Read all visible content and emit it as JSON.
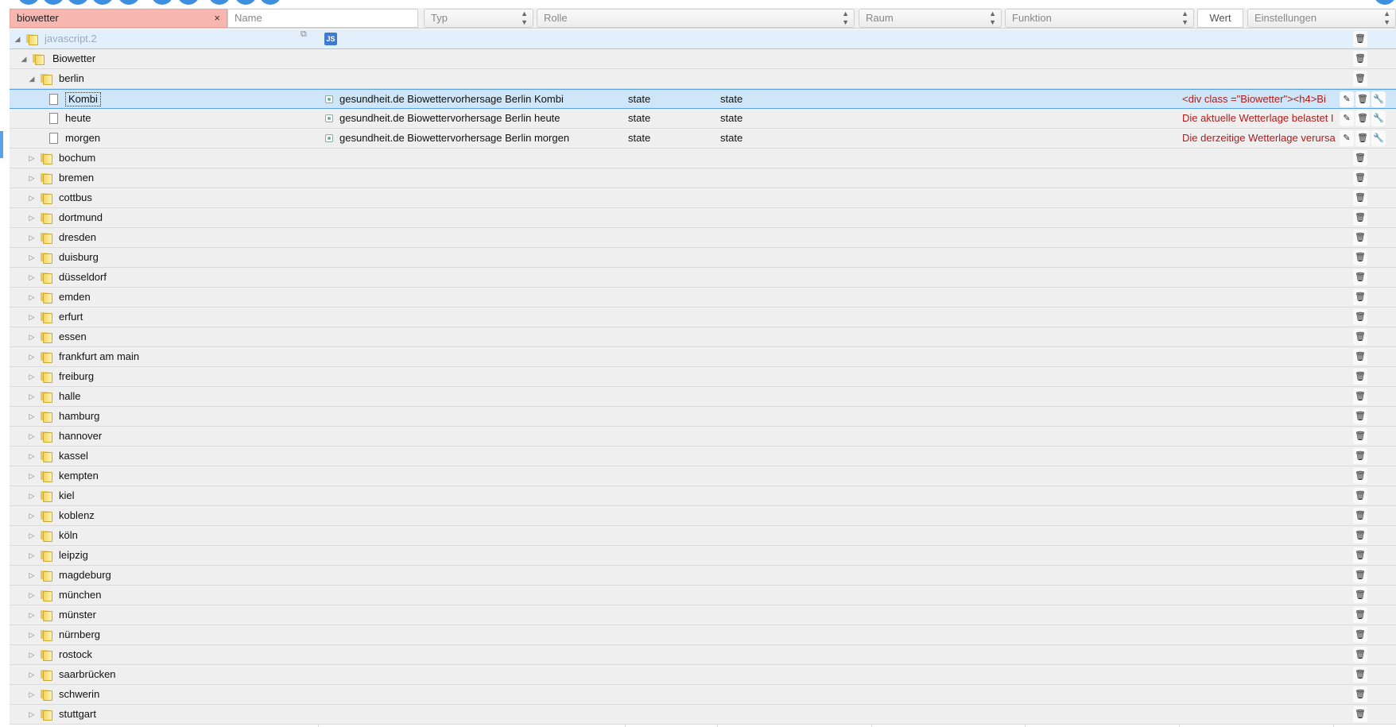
{
  "filters": {
    "search_value": "biowetter",
    "clear_symbol": "×",
    "name_placeholder": "Name",
    "typ_label": "Typ",
    "rolle_label": "Rolle",
    "raum_label": "Raum",
    "funktion_label": "Funktion",
    "wert_label": "Wert",
    "einstellungen_label": "Einstellungen"
  },
  "adapter_row": {
    "label": "javascript.2",
    "js_icon_text": "JS"
  },
  "root_folder": {
    "label": "Biowetter"
  },
  "berlin_folder": {
    "label": "berlin"
  },
  "states": [
    {
      "id": "Kombi",
      "name": "gesundheit.de Biowettervorhersage Berlin Kombi",
      "type": "state",
      "role": "state",
      "value": "<div class =\"Biowetter\"><h4>Bi",
      "selected": true,
      "has_settings": true
    },
    {
      "id": "heute",
      "name": "gesundheit.de Biowettervorhersage Berlin heute",
      "type": "state",
      "role": "state",
      "value": "Die aktuelle Wetterlage belastet I",
      "selected": false,
      "has_settings": true
    },
    {
      "id": "morgen",
      "name": "gesundheit.de Biowettervorhersage Berlin morgen",
      "type": "state",
      "role": "state",
      "value": "Die derzeitige Wetterlage verursa",
      "selected": false,
      "has_settings": true
    }
  ],
  "cities": [
    "bochum",
    "bremen",
    "cottbus",
    "dortmund",
    "dresden",
    "duisburg",
    "düsseldorf",
    "emden",
    "erfurt",
    "essen",
    "frankfurt am main",
    "freiburg",
    "halle",
    "hamburg",
    "hannover",
    "kassel",
    "kempten",
    "kiel",
    "koblenz",
    "köln",
    "leipzig",
    "magdeburg",
    "münchen",
    "münster",
    "nürnberg",
    "rostock",
    "saarbrücken",
    "schwerin",
    "stuttgart"
  ],
  "icons": {
    "delete": "trash-icon",
    "edit": "pencil-icon",
    "settings": "wrench-icon",
    "expanded": "triangle-down-icon",
    "collapsed": "triangle-right-icon"
  },
  "colors": {
    "search_bg": "#f7b7b0",
    "selected_row": "#cfe6f8",
    "value_text": "#b21b1b",
    "accent": "#3e8fe0"
  }
}
